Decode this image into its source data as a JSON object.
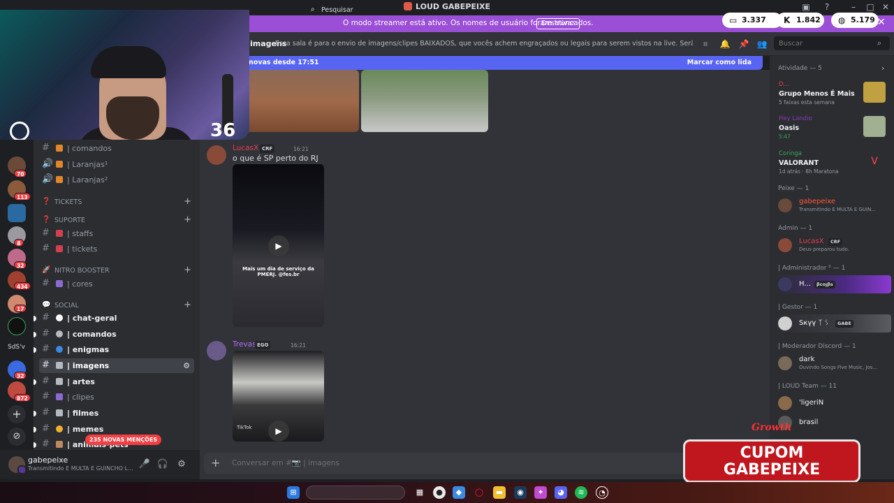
{
  "window": {
    "title": "LOUD GABEPEIXE"
  },
  "banner": {
    "message": "O modo streamer está ativo. Os nomes de usuário foram truncados.",
    "button_label": "Desativar",
    "stats": [
      {
        "icon": "chat-bubble-icon",
        "value": "3.337"
      },
      {
        "icon": "kick-icon",
        "value": "1.842"
      },
      {
        "icon": "globe-icon",
        "value": "5.179"
      }
    ]
  },
  "rail": {
    "badges": [
      "70",
      "113",
      "8",
      "32",
      "434",
      "17",
      "32",
      "872"
    ],
    "folder_label": "SdS'v"
  },
  "sidebar": {
    "channels_top": [
      {
        "label": "| comandos"
      },
      {
        "label": "| Laranjas¹"
      },
      {
        "label": "| Laranjas²"
      }
    ],
    "categories": [
      {
        "label": "TICKETS"
      },
      {
        "label": "SUPORTE"
      },
      {
        "label": "NITRO BOOSTER"
      },
      {
        "label": "SOCIAL"
      }
    ],
    "suporte_channels": [
      {
        "label": "| staffs"
      },
      {
        "label": "| tickets"
      }
    ],
    "nitro_channels": [
      {
        "label": "| cores"
      }
    ],
    "social_channels": [
      {
        "label": "| chat-geral"
      },
      {
        "label": "| comandos"
      },
      {
        "label": "| enigmas"
      },
      {
        "label": "| imagens"
      },
      {
        "label": "| artes"
      },
      {
        "label": "| clipes"
      },
      {
        "label": "| filmes"
      },
      {
        "label": "| memes"
      },
      {
        "label": "| animais-pets"
      }
    ],
    "mentions_badge": "235 NOVAS MENÇÕES"
  },
  "user_panel": {
    "username": "gabepeixe",
    "status": "Transmitindo E MULTA E GUINCHO L..."
  },
  "header": {
    "channel": "imagens",
    "topic": "Essa sala é para o envio de imagens/clipes BAIXADOS, que vocês achem engraçados ou legais para serem vistos na live. Serão apagados prints de ou...",
    "search_placeholder": "Buscar"
  },
  "new_messages": {
    "text": "novas desde 17:51",
    "mark_read": "Marcar como lida"
  },
  "messages": [
    {
      "author": "LucasX",
      "tag": "CRF",
      "time": "16:21",
      "text": "o que é SP perto do RJ",
      "video_caption": "Mais um dia de serviço da PMERJ. @fes.br"
    },
    {
      "author": "Trevas",
      "tag": "EGO",
      "time": "16:21",
      "video_watermark": "TikTok"
    }
  ],
  "input": {
    "placeholder": "Conversar em #📷 | imagens"
  },
  "members": {
    "activity_header": "Atividade — 5",
    "activities": [
      {
        "user": "D...",
        "title": "Grupo Menos É Mais",
        "sub": "5 faixas esta semana"
      },
      {
        "user": "Hey Landio",
        "title": "Oasis",
        "sub": "5:47"
      },
      {
        "user": "Coringa",
        "title": "VALORANT",
        "sub": "1d atrás  ·  8h Maratona"
      }
    ],
    "groups": [
      {
        "header": "Peixe — 1",
        "members": [
          {
            "name": "gabepeixe",
            "status": "Transmitindo E MULTA E GUIN..."
          }
        ]
      },
      {
        "header": "Admin — 1",
        "members": [
          {
            "name": "LucasX",
            "tag": "CRF",
            "status": "Deus preparou tudo."
          }
        ]
      },
      {
        "header": "| Administrador ² — 1",
        "members": [
          {
            "name": "H...",
            "tag": "βcoȷβs"
          }
        ]
      },
      {
        "header": "| Gestor — 1",
        "members": [
          {
            "name": "Sкүү ᛉ ᛊ",
            "tag": "GABE"
          }
        ]
      },
      {
        "header": "| Moderador Discord — 1",
        "members": [
          {
            "name": "dark",
            "status": "Ouvindo Songs Five Music, Jos..."
          }
        ]
      },
      {
        "header": "| LOUD Team — 11",
        "members": [
          {
            "name": "'ligeriN"
          },
          {
            "name": "brasil"
          }
        ]
      }
    ]
  },
  "overlay": {
    "webcam_count": "36",
    "promo_logo": "Growth",
    "promo_line1": "CUPOM",
    "promo_line2": "GABEPEIXE"
  },
  "taskbar": {
    "search_label": "Pesquisar"
  },
  "colors": {
    "accent": "#5865f2",
    "banner": "#9b4ed6",
    "lucas_name": "#e83e52",
    "trevas_name": "#b46cf0",
    "peixe_name": "#ff5a3c",
    "green_activity": "#3ba55d"
  }
}
